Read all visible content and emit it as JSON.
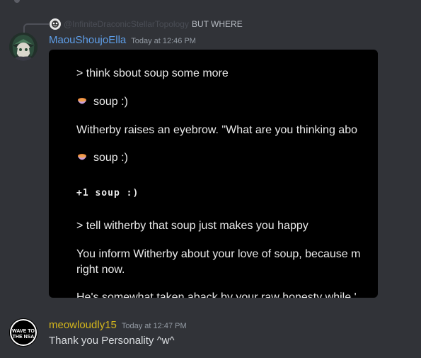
{
  "reply": {
    "username": "@InfiniteDraconicStellarTopology",
    "text": "BUT WHERE"
  },
  "messages": [
    {
      "username": "MaouShoujoElla",
      "timestamp": "Today at 12:46 PM",
      "username_color": "#5e9ee8"
    },
    {
      "username": "meowloudly15",
      "timestamp": "Today at 12:47 PM",
      "username_color": "#d4b61c",
      "text": "Thank you Personality ^w^",
      "avatar_text": [
        "WAVE TO",
        "THE NSA"
      ]
    }
  ],
  "game_screen": {
    "lines": [
      "> think sbout soup some more",
      "soup :)",
      "Witherby raises an eyebrow. \"What are you thinking abo",
      "soup :)",
      "+1 soup :)",
      "> tell witherby that soup just makes you happy",
      "You inform Witherby about your love of soup, because m",
      "right now.",
      "He's somewhat taken aback by your raw honesty while '"
    ],
    "icons": [
      "soup-bowl-icon",
      "soup-bowl-icon"
    ]
  },
  "colors": {
    "background": "#313338",
    "mention": "#4a4d55",
    "timestamp": "#949ba4"
  }
}
